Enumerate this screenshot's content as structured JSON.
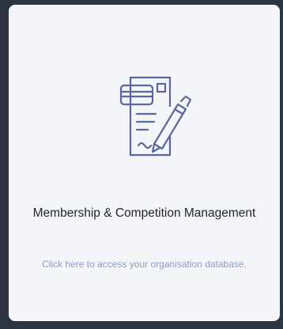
{
  "card": {
    "icon": "document-signature-icon",
    "title": "Membership & Competition Management",
    "description": "Click here to access your organisation database.",
    "icon_color": "#5a67a3",
    "title_color": "#1f2230",
    "description_color": "#8f9bc2"
  }
}
